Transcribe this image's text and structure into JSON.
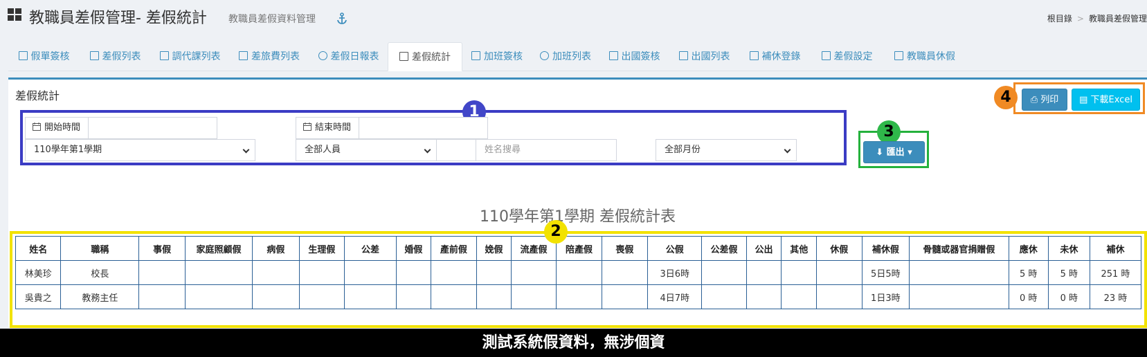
{
  "header": {
    "title": "教職員差假管理- 差假統計",
    "subtitle": "教職員差假資料管理",
    "breadcrumb": [
      "根目錄",
      "教職員差假管理"
    ]
  },
  "tabs": [
    {
      "label": "假單簽核",
      "icon": "hourglass-icon"
    },
    {
      "label": "差假列表",
      "icon": "list-icon"
    },
    {
      "label": "調代課列表",
      "icon": "table-icon"
    },
    {
      "label": "差旅費列表",
      "icon": "bar-chart-icon"
    },
    {
      "label": "差假日報表",
      "icon": "pie-chart-icon"
    },
    {
      "label": "差假統計",
      "icon": "calculator-icon",
      "active": true
    },
    {
      "label": "加班簽核",
      "icon": "file-icon"
    },
    {
      "label": "加班列表",
      "icon": "clock-icon"
    },
    {
      "label": "出國簽核",
      "icon": "file-icon"
    },
    {
      "label": "出國列表",
      "icon": "file-icon"
    },
    {
      "label": "補休登錄",
      "icon": "battery-icon"
    },
    {
      "label": "差假設定",
      "icon": "gears-icon"
    },
    {
      "label": "教職員休假",
      "icon": "sliders-icon"
    }
  ],
  "panel": {
    "title": "差假統計",
    "print_label": "列印",
    "excel_label": "下載Excel",
    "export_label": "匯出"
  },
  "filters": {
    "start_label": "開始時間",
    "start_value": "",
    "end_label": "結束時間",
    "end_value": "",
    "semester": "110學年第1學期",
    "staff": "全部人員",
    "name_placeholder": "姓名搜尋",
    "month": "全部月份"
  },
  "annotations": [
    "1",
    "2",
    "3",
    "4"
  ],
  "report_title": "110學年第1學期 差假統計表",
  "table": {
    "columns": [
      "姓名",
      "職稱",
      "事假",
      "家庭照顧假",
      "病假",
      "生理假",
      "公差",
      "婚假",
      "產前假",
      "娩假",
      "流產假",
      "陪產假",
      "喪假",
      "公假",
      "公差假",
      "公出",
      "其他",
      "休假",
      "補休假",
      "骨髓或器官捐贈假",
      "應休",
      "未休",
      "補休"
    ],
    "rows": [
      [
        "林美珍",
        "校長",
        "",
        "",
        "",
        "",
        "",
        "",
        "",
        "",
        "",
        "",
        "",
        "3日6時",
        "",
        "",
        "",
        "",
        "5日5時",
        "",
        "5 時",
        "5 時",
        "251 時"
      ],
      [
        "吳貴之",
        "教務主任",
        "",
        "",
        "",
        "",
        "",
        "",
        "",
        "",
        "",
        "",
        "",
        "4日7時",
        "",
        "",
        "",
        "",
        "1日3時",
        "",
        "0 時",
        "0 時",
        "23 時"
      ]
    ]
  },
  "watermark": "測試系統假資料，無涉個資",
  "colors": {
    "primary": "#3c8dbc",
    "info": "#00c0ef",
    "annotation_blue": "#3b3cc4",
    "annotation_yellow": "#f2e200",
    "annotation_green": "#24b13c",
    "annotation_orange": "#f08a24"
  }
}
